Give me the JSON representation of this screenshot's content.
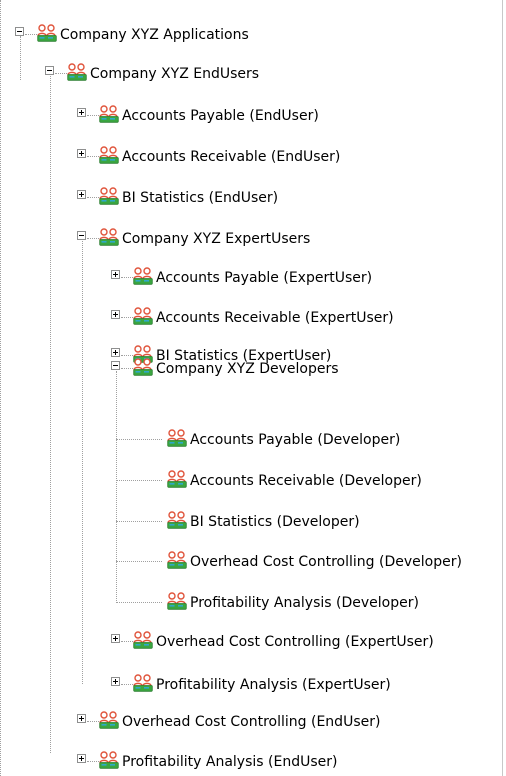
{
  "tree": {
    "root": {
      "label": "Company XYZ Applications",
      "icon": "user-group-icon",
      "expanded": true,
      "children": {
        "endusers": {
          "label": "Company XYZ EndUsers",
          "icon": "user-group-icon",
          "expanded": true,
          "items": [
            "Accounts Payable (EndUser)",
            "Accounts Receivable (EndUser)",
            "BI Statistics (EndUser)"
          ],
          "expertusers": {
            "label": "Company XYZ ExpertUsers",
            "icon": "user-group-icon",
            "expanded": true,
            "items": [
              "Accounts Payable (ExpertUser)",
              "Accounts Receivable (ExpertUser)",
              "BI Statistics (ExpertUser)"
            ],
            "developers": {
              "label": "Company XYZ Developers",
              "icon": "user-group-icon",
              "expanded": true,
              "items": [
                "Accounts Payable (Developer)",
                "Accounts Receivable (Developer)",
                "BI Statistics (Developer)",
                "Overhead Cost Controlling (Developer)",
                "Profitability Analysis (Developer)"
              ]
            },
            "items_after": [
              "Overhead Cost Controlling (ExpertUser)",
              "Profitability Analysis (ExpertUser)"
            ]
          },
          "items_after": [
            "Overhead Cost Controlling (EndUser)",
            "Profitability Analysis (EndUser)"
          ]
        }
      }
    },
    "colors": {
      "icon_green": "#3aa640",
      "icon_red": "#e0533a",
      "icon_cyan": "#2fa8c8",
      "tree_line": "#a0a0a0",
      "expander_border": "#8e8f8f"
    }
  }
}
